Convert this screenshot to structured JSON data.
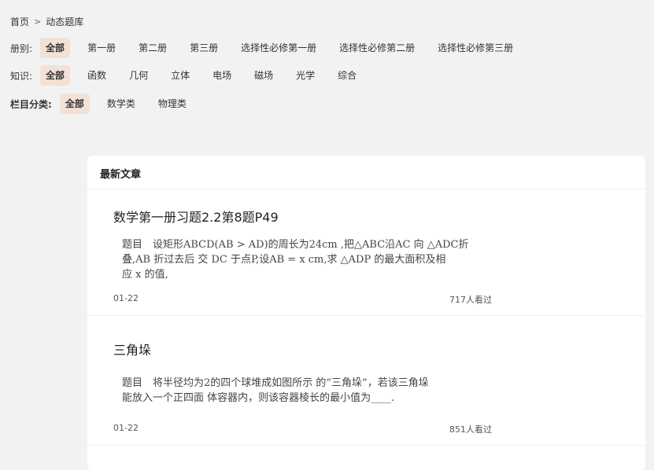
{
  "breadcrumb": {
    "home": "首页",
    "separator": ">",
    "current": "动态题库"
  },
  "filters": [
    {
      "label": "册别:",
      "options": [
        "全部",
        "第一册",
        "第二册",
        "第三册",
        "选择性必修第一册",
        "选择性必修第二册",
        "选择性必修第三册"
      ],
      "active": "全部"
    },
    {
      "label": "知识:",
      "options": [
        "全部",
        "函数",
        "几何",
        "立体",
        "电场",
        "磁场",
        "光学",
        "综合"
      ],
      "active": "全部"
    },
    {
      "label": "栏目分类:",
      "options": [
        "全部",
        "数学类",
        "物理类"
      ],
      "active": "全部"
    }
  ],
  "panel": {
    "title": "最新文章",
    "articles": [
      {
        "title": "数学第一册习题2.2第8题P49",
        "body_lines": [
          "题目　设矩形ABCD(AB > AD)的周长为24cm ,把△ABC沿AC 向 △ADC折",
          "叠,AB 折过去后 交 DC 于点P,设AB = x cm,求 △ADP 的最大面积及相",
          "应 x 的值,"
        ],
        "date": "01-22",
        "views": "717人看过"
      },
      {
        "title": "三角垛",
        "body_lines": [
          "题目　将半径均为2的四个球堆成如图所示 的“三角垛”，若该三角垛",
          "能放入一个正四面 体容器内，则该容器棱长的最小值为____."
        ],
        "date": "01-22",
        "views": "851人看过"
      }
    ]
  },
  "colors": {
    "background": "#f2f2f2",
    "active_chip": "#f3e1d6",
    "panel": "#ffffff"
  }
}
